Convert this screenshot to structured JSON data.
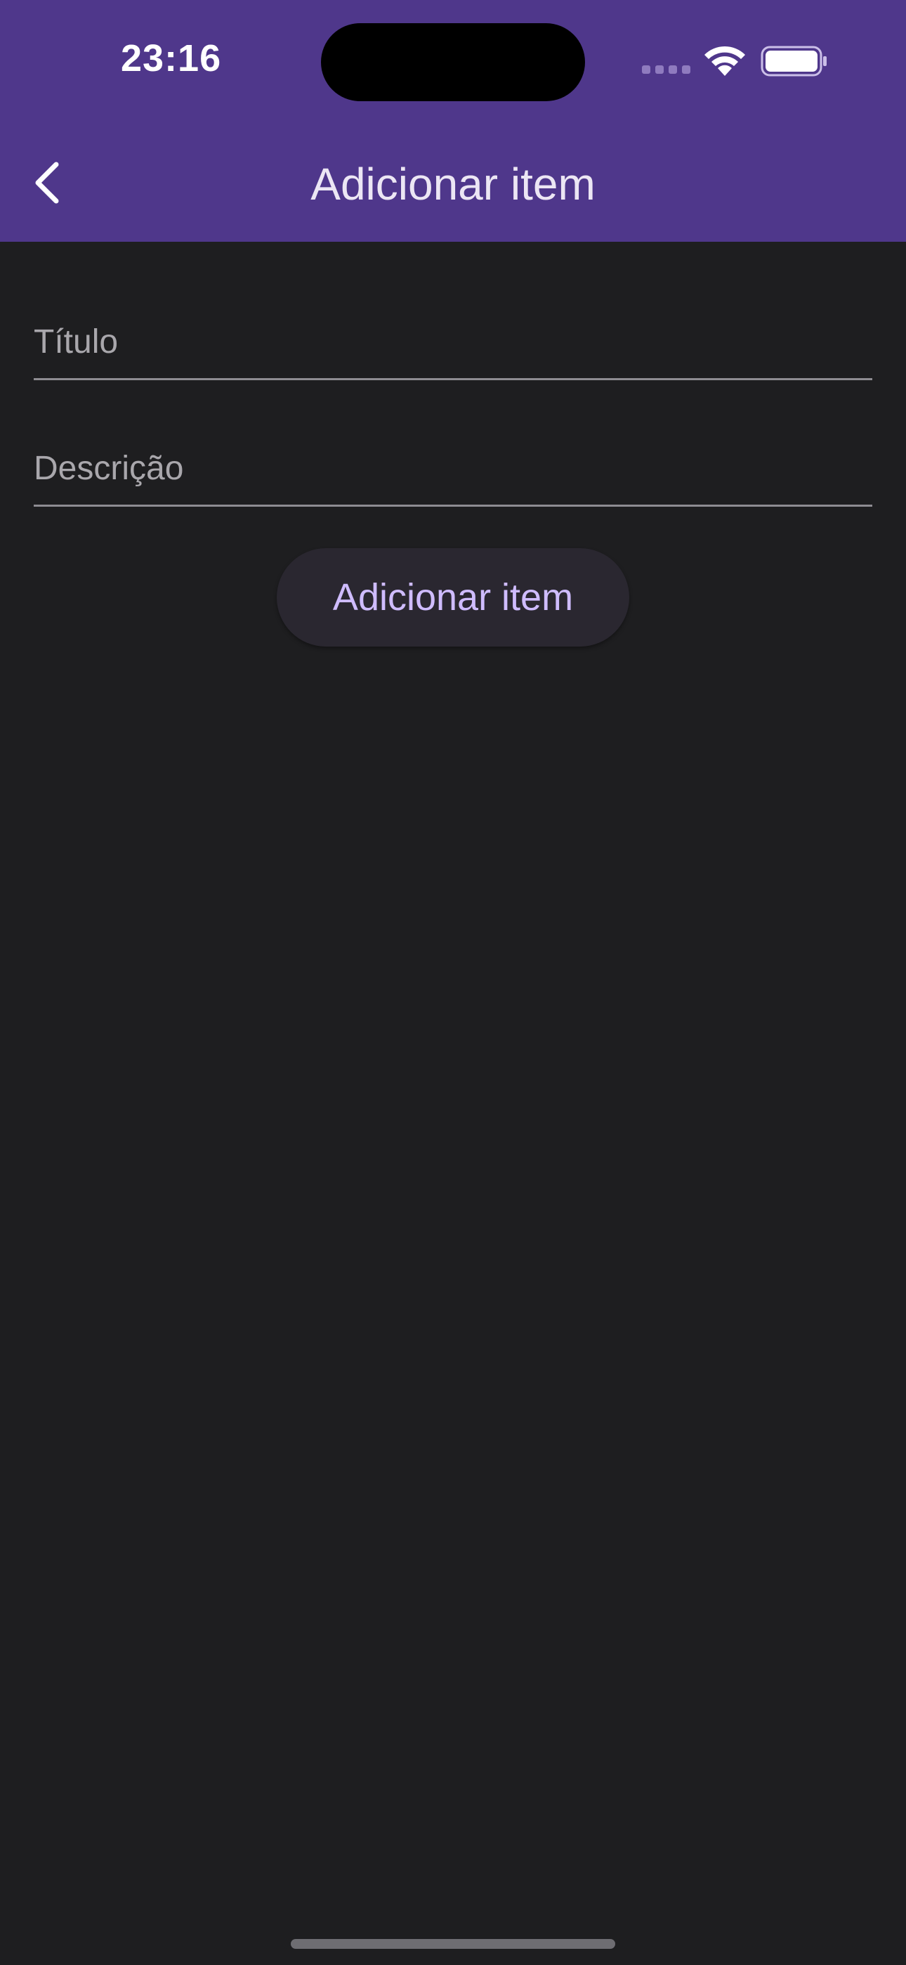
{
  "status_bar": {
    "time": "23:16"
  },
  "app_bar": {
    "title": "Adicionar item",
    "back_icon": "chevron-left-icon",
    "background_color": "#4f378b"
  },
  "form": {
    "title_field": {
      "placeholder": "Título",
      "value": ""
    },
    "description_field": {
      "placeholder": "Descrição",
      "value": ""
    },
    "submit_label": "Adicionar item"
  },
  "colors": {
    "accent": "#cfbcff",
    "background": "#1e1e20"
  }
}
